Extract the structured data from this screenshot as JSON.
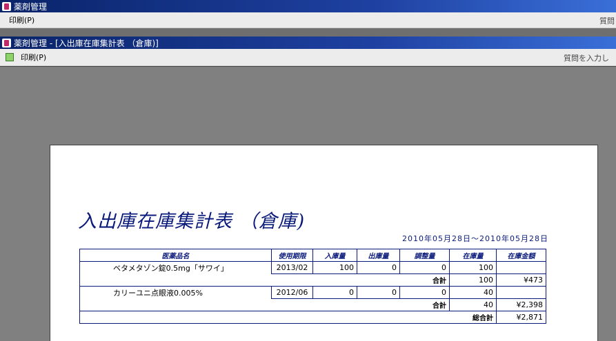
{
  "outer_window": {
    "title": "薬剤管理",
    "menu": [
      {
        "label": "印刷(P)"
      }
    ],
    "help_text": "質問"
  },
  "inner_window": {
    "title": "薬剤管理 - [入出庫在庫集計表 （倉庫)]",
    "menu": [
      {
        "label": "印刷(P)"
      }
    ],
    "help_text": "質問を入力し"
  },
  "report": {
    "title": "入出庫在庫集計表 （倉庫)",
    "date_range": "2010年05月28日～2010年05月28日",
    "columns": [
      "医薬品名",
      "使用期限",
      "入庫量",
      "出庫量",
      "調整量",
      "在庫量",
      "在庫金額"
    ],
    "items": [
      {
        "name": "ベタメタゾン錠0.5mg「サワイ」",
        "expiry": "2013/02",
        "in": "100",
        "out": "0",
        "adjust": "0",
        "stock": "100",
        "amount": "",
        "subtotal_label": "合計",
        "subtotal_stock": "100",
        "subtotal_amount": "¥473"
      },
      {
        "name": "カリーユニ点眼液0.005%",
        "expiry": "2012/06",
        "in": "0",
        "out": "0",
        "adjust": "0",
        "stock": "40",
        "amount": "",
        "subtotal_label": "合計",
        "subtotal_stock": "40",
        "subtotal_amount": "¥2,398"
      }
    ],
    "grand_total_label": "総合計",
    "grand_total_amount": "¥2,871"
  },
  "colors": {
    "title_bar": "#0a246a",
    "report_blue": "#0a1a7a",
    "workspace": "#808080"
  }
}
